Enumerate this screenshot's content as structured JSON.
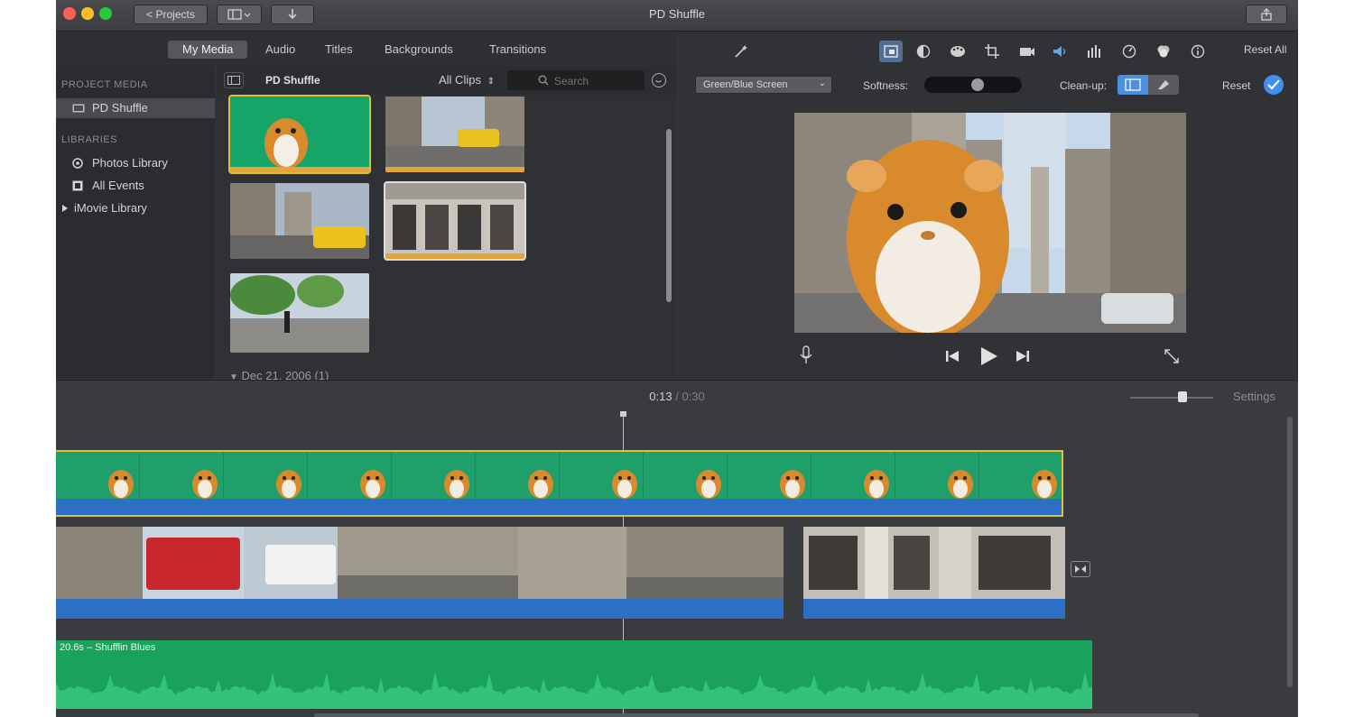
{
  "window": {
    "title": "PD Shuffle",
    "projects_label": "< Projects"
  },
  "media_tabs": [
    {
      "label": "My Media"
    },
    {
      "label": "Audio"
    },
    {
      "label": "Titles"
    },
    {
      "label": "Backgrounds"
    },
    {
      "label": "Transitions"
    }
  ],
  "sidebar": {
    "project_media_heading": "PROJECT MEDIA",
    "project_item": "PD Shuffle",
    "libraries_heading": "LIBRARIES",
    "library_items": [
      {
        "label": "Photos Library"
      },
      {
        "label": "All Events"
      },
      {
        "label": "iMovie Library"
      }
    ]
  },
  "browser": {
    "event_title": "PD Shuffle",
    "filter_value": "All Clips",
    "search_placeholder": "Search",
    "date_group": "Dec 21, 2006 (1)"
  },
  "adjust": {
    "effect_select": "Green/Blue Screen",
    "softness_label": "Softness:",
    "softness_value": 0.55,
    "cleanup_label": "Clean-up:",
    "reset_all_label": "Reset All",
    "reset_label": "Reset"
  },
  "timeline": {
    "current_time": "0:13",
    "separator": "/",
    "total_time": "0:30",
    "settings_label": "Settings",
    "zoom_value": 0.65,
    "audio_label": "20.6s – Shufflin Blues"
  },
  "colors": {
    "selected_clip_border": "#d9c23a",
    "green_screen": "#1fa06a",
    "audio_track": "#1aa25c",
    "clip_underline": "#2d6fc4",
    "accent": "#4f8bd9"
  }
}
